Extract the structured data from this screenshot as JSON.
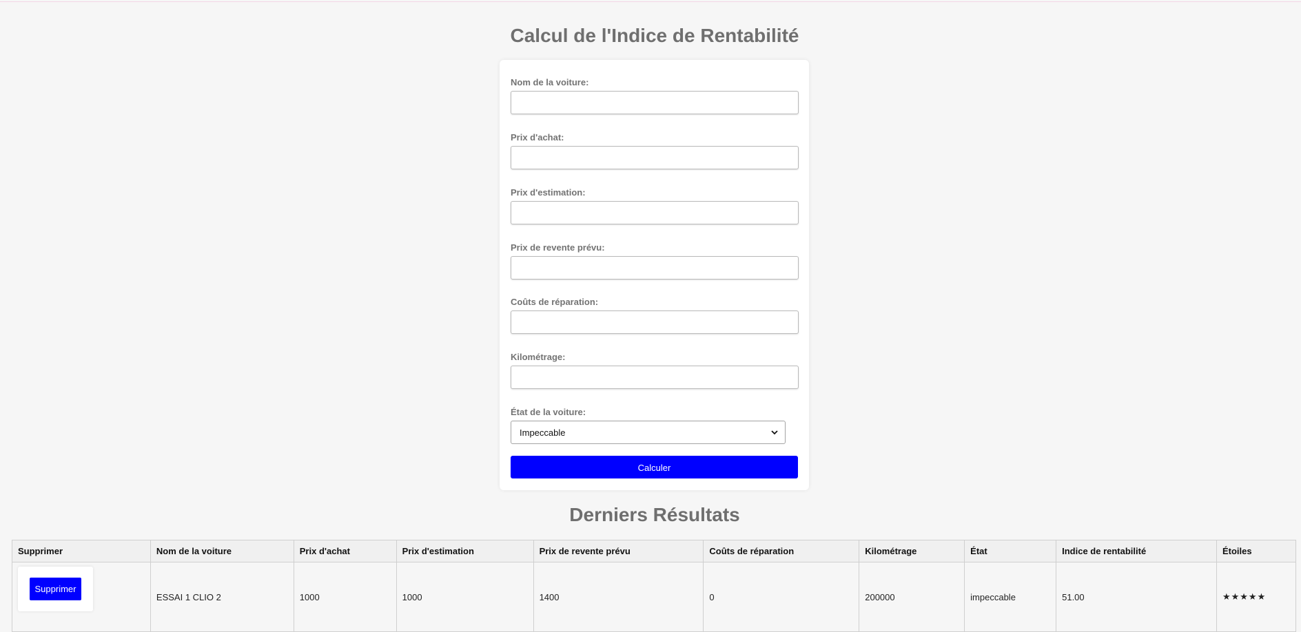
{
  "page": {
    "title": "Calcul de l'Indice de Rentabilité",
    "results_title": "Derniers Résultats"
  },
  "form": {
    "fields": [
      {
        "label": "Nom de la voiture:",
        "value": "",
        "placeholder": ""
      },
      {
        "label": "Prix d'achat:",
        "value": "",
        "placeholder": ""
      },
      {
        "label": "Prix d'estimation:",
        "value": "",
        "placeholder": ""
      },
      {
        "label": "Prix de revente prévu:",
        "value": "",
        "placeholder": ""
      },
      {
        "label": "Coûts de réparation:",
        "value": "",
        "placeholder": ""
      },
      {
        "label": "Kilométrage:",
        "value": "",
        "placeholder": ""
      }
    ],
    "condition": {
      "label": "État de la voiture:",
      "selected": "Impeccable"
    },
    "submit_label": "Calculer"
  },
  "table": {
    "headers": [
      "Supprimer",
      "Nom de la voiture",
      "Prix d'achat",
      "Prix d'estimation",
      "Prix de revente prévu",
      "Coûts de réparation",
      "Kilométrage",
      "État",
      "Indice de rentabilité",
      "Étoiles"
    ],
    "rows": [
      {
        "delete_label": "Supprimer",
        "name": "ESSAI 1 CLIO 2",
        "purchase": "1000",
        "estimate": "1000",
        "resale": "1400",
        "repair": "0",
        "mileage": "200000",
        "state": "impeccable",
        "index": "51.00",
        "stars": "★★★★★"
      }
    ]
  },
  "colors": {
    "accent": "#0000ff",
    "heading": "#6f6f6f",
    "background": "#f6f6f6"
  }
}
